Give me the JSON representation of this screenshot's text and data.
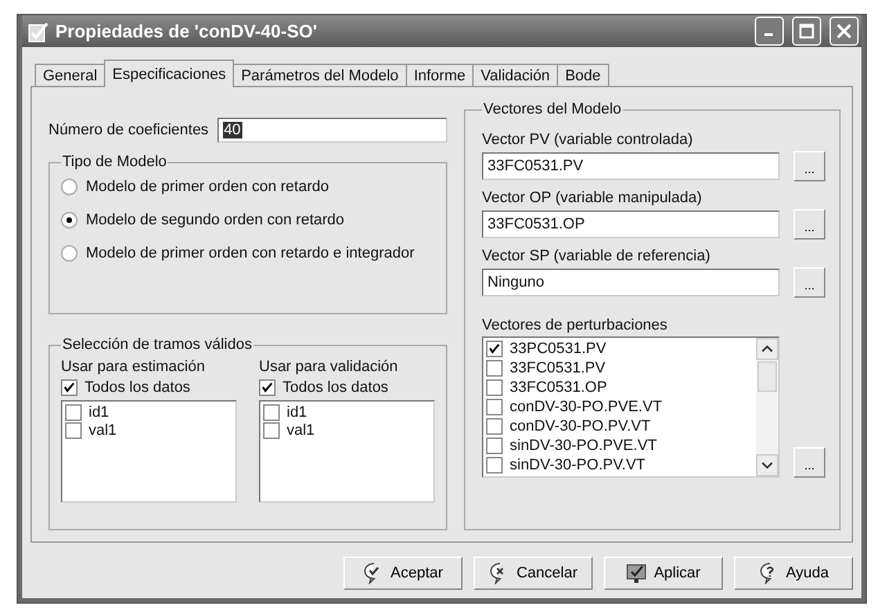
{
  "window": {
    "title": "Propiedades de 'conDV-40-SO'"
  },
  "tabs": [
    {
      "label": "General",
      "selected": false
    },
    {
      "label": "Especificaciones",
      "selected": true
    },
    {
      "label": "Parámetros del Modelo",
      "selected": false
    },
    {
      "label": "Informe",
      "selected": false
    },
    {
      "label": "Validación",
      "selected": false
    },
    {
      "label": "Bode",
      "selected": false
    }
  ],
  "coefficients": {
    "label": "Número de coeficientes",
    "value": "40"
  },
  "model_type": {
    "title": "Tipo de Modelo",
    "options": [
      {
        "label": "Modelo de primer orden con retardo",
        "selected": false
      },
      {
        "label": "Modelo de segundo orden con retardo",
        "selected": true
      },
      {
        "label": "Modelo de primer orden con retardo e integrador",
        "selected": false
      }
    ]
  },
  "segments": {
    "title": "Selección de tramos válidos",
    "lists": [
      {
        "label": "Usar para estimación",
        "all_data": {
          "label": "Todos los datos",
          "checked": true
        },
        "items": [
          {
            "label": "id1",
            "checked": false
          },
          {
            "label": "val1",
            "checked": false
          }
        ]
      },
      {
        "label": "Usar para validación",
        "all_data": {
          "label": "Todos los datos",
          "checked": true
        },
        "items": [
          {
            "label": "id1",
            "checked": false
          },
          {
            "label": "val1",
            "checked": false
          }
        ]
      }
    ]
  },
  "vectors": {
    "title": "Vectores del Modelo",
    "fields": [
      {
        "label": "Vector PV (variable controlada)",
        "value": "33FC0531.PV",
        "button": "..."
      },
      {
        "label": "Vector OP (variable manipulada)",
        "value": "33FC0531.OP",
        "button": "..."
      },
      {
        "label": "Vector SP (variable de referencia)",
        "value": "Ninguno",
        "button": "..."
      }
    ],
    "disturbances": {
      "label": "Vectores de perturbaciones",
      "button": "...",
      "items": [
        {
          "label": "33PC0531.PV",
          "checked": true
        },
        {
          "label": "33FC0531.PV",
          "checked": false
        },
        {
          "label": "33FC0531.OP",
          "checked": false
        },
        {
          "label": "conDV-30-PO.PVE.VT",
          "checked": false
        },
        {
          "label": "conDV-30-PO.PV.VT",
          "checked": false
        },
        {
          "label": "sinDV-30-PO.PVE.VT",
          "checked": false
        },
        {
          "label": "sinDV-30-PO.PV.VT",
          "checked": false
        }
      ]
    }
  },
  "buttons": [
    {
      "label": "Aceptar",
      "kind": "accept"
    },
    {
      "label": "Cancelar",
      "kind": "cancel"
    },
    {
      "label": "Aplicar",
      "kind": "apply"
    },
    {
      "label": "Ayuda",
      "kind": "help"
    }
  ]
}
